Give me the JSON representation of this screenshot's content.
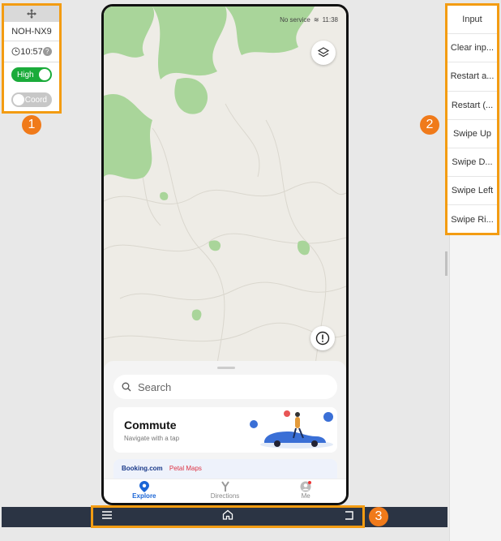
{
  "left_panel": {
    "device_name": "NOH-NX9",
    "time": "10:57",
    "help": "?",
    "quality_toggle": {
      "label": "High",
      "on": true
    },
    "coord_toggle": {
      "label": "Coord",
      "on": false
    },
    "badge": "1"
  },
  "phone": {
    "status": {
      "carrier": "No service",
      "time": "11:38"
    },
    "search": {
      "placeholder": "Search"
    },
    "commute": {
      "title": "Commute",
      "subtitle": "Navigate with a tap"
    },
    "promo": {
      "booking": "Booking.com",
      "petal": "Petal Maps"
    },
    "nav": [
      {
        "label": "Explore",
        "icon": "location-pin-icon",
        "active": true
      },
      {
        "label": "Directions",
        "icon": "directions-icon",
        "active": false
      },
      {
        "label": "Me",
        "icon": "profile-icon",
        "active": false
      }
    ],
    "colors": {
      "accent": "#1a65d6",
      "forest": "#a9d59a",
      "terrain": "#eeece6"
    }
  },
  "right_panel": {
    "buttons": [
      "Input",
      "Clear inp...",
      "Restart a...",
      "Restart (...",
      "Swipe Up",
      "Swipe D...",
      "Swipe Left",
      "Swipe Ri..."
    ],
    "badge": "2"
  },
  "bottom_bar": {
    "buttons": [
      {
        "name": "menu-button",
        "icon": "menu-icon"
      },
      {
        "name": "home-button",
        "icon": "home-icon"
      },
      {
        "name": "back-button",
        "icon": "back-icon"
      }
    ],
    "badge": "3"
  }
}
